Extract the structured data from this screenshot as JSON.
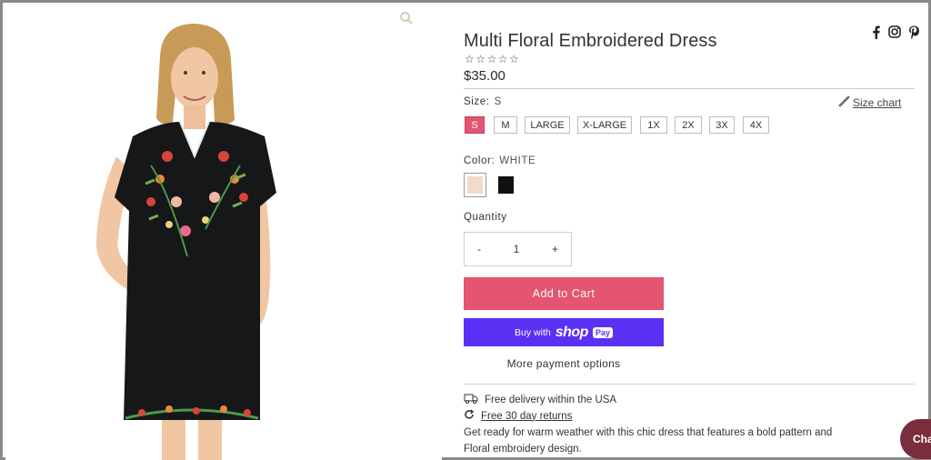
{
  "product": {
    "title": "Multi Floral Embroidered Dress",
    "rating_stars": "☆☆☆☆☆",
    "price": "$35.00"
  },
  "size": {
    "label": "Size:",
    "selected": "S",
    "chart_link": "Size chart",
    "options": [
      "S",
      "M",
      "LARGE",
      "X-LARGE",
      "1X",
      "2X",
      "3X",
      "4X"
    ]
  },
  "color": {
    "label": "Color:",
    "selected": "WHITE",
    "swatches": [
      "#f1dcc9",
      "#111111"
    ]
  },
  "quantity": {
    "label": "Quantity",
    "minus": "-",
    "value": "1",
    "plus": "+"
  },
  "buttons": {
    "add_to_cart": "Add to Cart",
    "buy_with": "Buy with",
    "shop": "shop",
    "pay": "Pay",
    "more_payment": "More payment options"
  },
  "features": {
    "delivery": "Free delivery within the USA",
    "returns": "Free 30 day returns"
  },
  "description": "Get ready for warm weather with this chic dress that features a bold pattern and Floral embroidery design.",
  "chat": {
    "label": "Cha"
  },
  "icons": [
    "search-icon",
    "facebook-icon",
    "instagram-icon",
    "pinterest-icon",
    "ruler-icon",
    "truck-icon",
    "refresh-icon"
  ],
  "colors": {
    "accent": "#e35570",
    "shop_pay": "#5a31f4",
    "chat": "#7a2e3d"
  }
}
